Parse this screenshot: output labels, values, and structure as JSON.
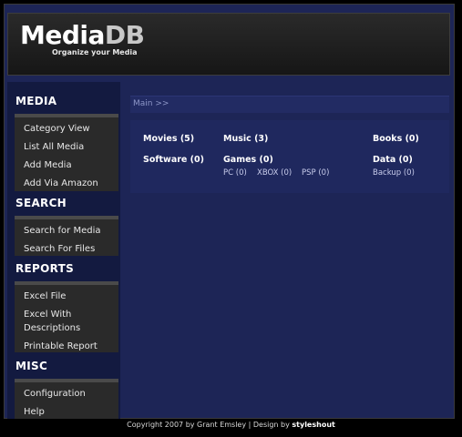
{
  "header": {
    "logo_part1": "Media",
    "logo_part2": "DB",
    "tagline": "Organize your Media"
  },
  "sidebar": {
    "media": {
      "title": "MEDIA",
      "items": [
        "Category View",
        "List All Media",
        "Add Media",
        "Add Via Amazon"
      ]
    },
    "search": {
      "title": "SEARCH",
      "items": [
        "Search for Media",
        "Search For Files"
      ]
    },
    "reports": {
      "title": "REPORTS",
      "items": [
        "Excel File",
        "Excel With",
        "Descriptions",
        "Printable Report"
      ]
    },
    "misc": {
      "title": "MISC",
      "items": [
        "Configuration",
        "Help"
      ]
    }
  },
  "main": {
    "breadcrumb": "Main >>",
    "categories": {
      "movies": "Movies (5)",
      "music": "Music (3)",
      "books": "Books (0)",
      "software": "Software (0)",
      "games": "Games (0)",
      "data": "Data (0)"
    },
    "games_subs": [
      "PC (0)",
      "XBOX (0)",
      "PSP (0)"
    ],
    "data_subs": [
      "Backup (0)"
    ]
  },
  "footer": {
    "text": "Copyright 2007 by Grant Emsley | Design by",
    "designer": "styleshout"
  }
}
